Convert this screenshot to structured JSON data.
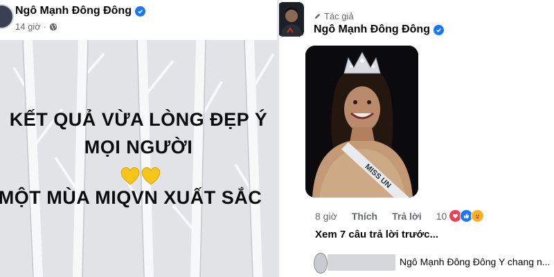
{
  "left_post": {
    "author_name": "Ngô Mạnh Đông Đông",
    "time": "14 giờ",
    "separator": "·",
    "image_text": {
      "line1": "KẾT QUẢ VỪA LÒNG ĐẸP Ý",
      "line2": "MỌI NGƯỜI",
      "line3": "MỘT MÙA MIQVN XUẤT SẮC"
    },
    "emoji": "yellow-hearts"
  },
  "right_comment": {
    "badge_label": "Tác giả",
    "author_name": "Ngô Mạnh Đông Đông",
    "image_caption_sash": "MISS UN",
    "actions": {
      "time": "8 giờ",
      "like": "Thích",
      "reply": "Trả lời"
    },
    "reaction_count": "10",
    "reaction_icons": [
      "heart-icon",
      "like-icon",
      "care-icon"
    ],
    "view_replies": "Xem 7 câu trả lời trước...",
    "reply_preview": "Ngô Mạnh Đông Đông Y chang n..."
  },
  "colors": {
    "verified_blue": "#1877f2",
    "meta_gray": "#65676b",
    "reply_bubble": "#f0f2f5",
    "heart_yellow": "#f5c518"
  }
}
